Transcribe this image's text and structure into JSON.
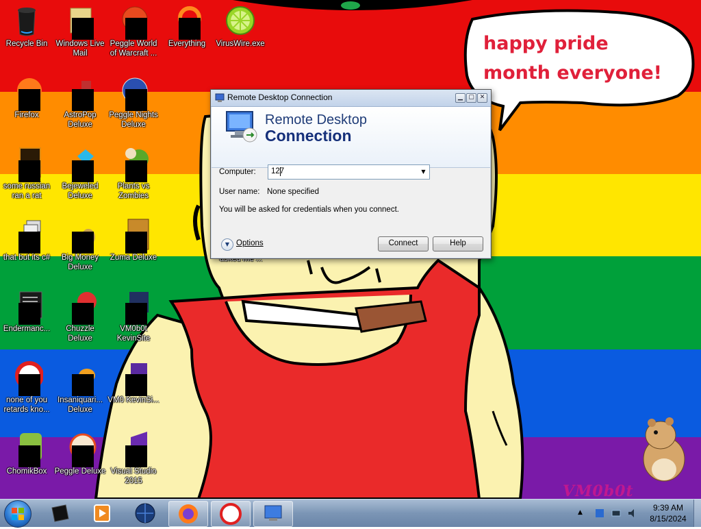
{
  "wallpaper": {
    "bubble_text": "happy pride month everyone!",
    "watermark": "VM0b0t"
  },
  "desktop_icons": [
    {
      "label": "Recycle Bin"
    },
    {
      "label": "Windows Live Mail"
    },
    {
      "label": "Peggle World of Warcraft ..."
    },
    {
      "label": "Everything"
    },
    {
      "label": "VirusWire.exe"
    },
    {
      "label": "Firefox"
    },
    {
      "label": "AstroPop Deluxe"
    },
    {
      "label": "Peggle Nights Deluxe"
    },
    {
      "label": "some russian ran a rat"
    },
    {
      "label": "Bejeweled Deluxe"
    },
    {
      "label": "Plants vs Zombies"
    },
    {
      "label": "that but its c#"
    },
    {
      "label": "Big Money Deluxe"
    },
    {
      "label": "Zuma Deluxe"
    },
    {
      "label": "Endermanc..."
    },
    {
      "label": "Chuzzle Deluxe"
    },
    {
      "label": "VM0b0t KevinSite"
    },
    {
      "label": "none of you retards kno..."
    },
    {
      "label": "Insaniquari... Deluxe"
    },
    {
      "label": "VM0 KevinSi..."
    },
    {
      "label": "ChomikBox"
    },
    {
      "label": "Peggle Deluxe"
    },
    {
      "label": "Visual Studio 2015"
    },
    {
      "label": "shit people asked me ..."
    }
  ],
  "rdp_window": {
    "title": "Remote Desktop Connection",
    "banner_line1": "Remote Desktop",
    "banner_line2": "Connection",
    "computer_label": "Computer:",
    "computer_value": "127",
    "username_label": "User name:",
    "username_value": "None specified",
    "credentials_note": "You will be asked for credentials when you connect.",
    "options_label": "Options",
    "connect_label": "Connect",
    "help_label": "Help"
  },
  "taskbar": {
    "items": [
      "start-orb",
      "media-center",
      "windows-media-player",
      "network-globe",
      "firefox",
      "peggle",
      "remote-desktop-connection"
    ],
    "clock_time": "9:39 AM",
    "clock_date": "8/15/2024"
  },
  "colors": {
    "taskbar": "#7b95b5",
    "banner_text": "#1f3c78",
    "bubble_text": "#e0203a"
  }
}
